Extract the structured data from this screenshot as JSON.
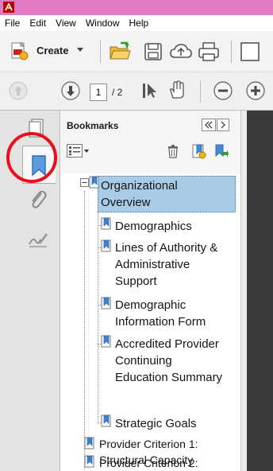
{
  "menu": {
    "items": [
      "File",
      "Edit",
      "View",
      "Window",
      "Help"
    ]
  },
  "toolbar": {
    "create_label": "Create",
    "page_current": "1",
    "page_total": "/ 2"
  },
  "panel": {
    "title": "Bookmarks"
  },
  "bookmarks": [
    {
      "label_lines": [
        "Organizational",
        "Overview"
      ],
      "selected": true
    },
    {
      "label_lines": [
        "Demographics"
      ]
    },
    {
      "label_lines": [
        "Lines of Authority &",
        "Administrative",
        "Support"
      ]
    },
    {
      "label_lines": [
        "Demographic",
        "Information Form"
      ]
    },
    {
      "label_lines": [
        "Accredited Provider",
        "Continuing",
        "Education Summary"
      ]
    },
    {
      "label_lines": [
        "Strategic Goals"
      ]
    },
    {
      "label_lines": [
        "Provider Criterion 1:",
        "Structural Capacity"
      ]
    },
    {
      "label_lines": [
        "Provider Criterion 2:"
      ]
    }
  ],
  "colors": {
    "titlebar": "#e37ac6",
    "selection": "#a8cce6",
    "highlight_circle": "#e8101a",
    "bookmark_icon": "#3f7fd0"
  },
  "icons": {
    "app": "acrobat-icon",
    "create": "create-pdf-icon",
    "open": "open-folder-icon",
    "save": "save-icon",
    "cloud": "cloud-upload-icon",
    "print": "print-icon",
    "prev_page": "arrow-up-icon",
    "next_page": "arrow-down-icon",
    "select_tool": "select-cursor-icon",
    "hand_tool": "hand-icon",
    "zoom_out": "zoom-out-icon",
    "zoom_in": "zoom-in-icon",
    "pages_panel": "page-thumbnails-icon",
    "bookmarks_panel": "bookmark-icon",
    "attachments_panel": "paperclip-icon",
    "signatures_panel": "signature-icon",
    "options": "options-menu-icon",
    "delete": "trash-icon",
    "new_bookmark": "new-bookmark-icon",
    "expand_bookmark": "expand-bookmark-icon",
    "collapse_panel": "collapse-left-icon",
    "expand_panel": "expand-right-icon"
  }
}
